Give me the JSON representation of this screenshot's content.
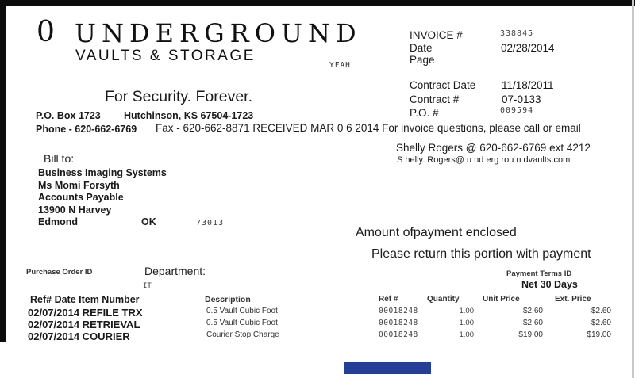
{
  "logo": {
    "zero": "0",
    "name": "UNDERGROUND",
    "subtitle": "VAULTS & STORAGE",
    "tagline": "For Security. Forever."
  },
  "scan_artifact": "YFAH",
  "invoice_meta": {
    "invoice_label": "INVOICE #",
    "invoice_value": "338845",
    "date_label": "Date",
    "date_value": "02/28/2014",
    "page_label": "Page",
    "contract_date_label": "Contract Date",
    "contract_date_value": "11/18/2011",
    "contract_num_label": "Contract #",
    "contract_num_value": "07-0133",
    "po_label": "P.O. #",
    "po_value": "009594"
  },
  "company": {
    "po_box": "P.O. Box 1723",
    "city_line": "Hutchinson, KS 67504-1723",
    "phone_line": "Phone - 620-662-6769",
    "fax_line": "Fax - 620-662-8871 RECEIVED MAR 0 6 2014 For invoice questions, please call or email",
    "contact_line": "Shelly Rogers @ 620-662-6769 ext 4212",
    "email_line": "S helly. Rogers@ u nd erg rou n dvaults.com"
  },
  "bill_to": {
    "label": "Bill to:",
    "company": "Business Imaging Systems",
    "attn": "Ms Momi Forsyth",
    "dept": "Accounts Payable",
    "street": "13900 N Harvey",
    "city": "Edmond",
    "state": "OK",
    "zip": "73013"
  },
  "remit": {
    "amount_line": "Amount ofpayment enclosed",
    "return_line": "Please return this portion with payment"
  },
  "order_info": {
    "purchase_order_label": "Purchase Order ID",
    "department_label": "Department:",
    "department_value": "IT",
    "payment_terms_label": "Payment Terms ID",
    "payment_terms_value": "Net 30 Days"
  },
  "line_items": {
    "headers": {
      "item": "Ref# Date Item Number",
      "description": "Description",
      "ref": "Ref #",
      "quantity": "Quantity",
      "unit_price": "Unit Price",
      "ext_price": "Ext. Price"
    },
    "rows": [
      {
        "item": "02/07/2014 REFILE TRX",
        "description": "0.5 Vault Cubic Foot",
        "ref": "00018248",
        "quantity": "1.00",
        "unit_price": "$2.60",
        "ext_price": "$2.60"
      },
      {
        "item": "02/07/2014 RETRIEVAL",
        "description": "0.5 Vault Cubic Foot",
        "ref": "00018248",
        "quantity": "1.00",
        "unit_price": "$2.60",
        "ext_price": "$2.60"
      },
      {
        "item": "02/07/2014 COURIER",
        "description": "Courier Stop Charge",
        "ref": "00018248",
        "quantity": "1.00",
        "unit_price": "$19.00",
        "ext_price": "$19.00"
      }
    ]
  },
  "colors": {
    "scan_bar_black": "#0c0c0c",
    "redaction_blue": "#253f96"
  }
}
